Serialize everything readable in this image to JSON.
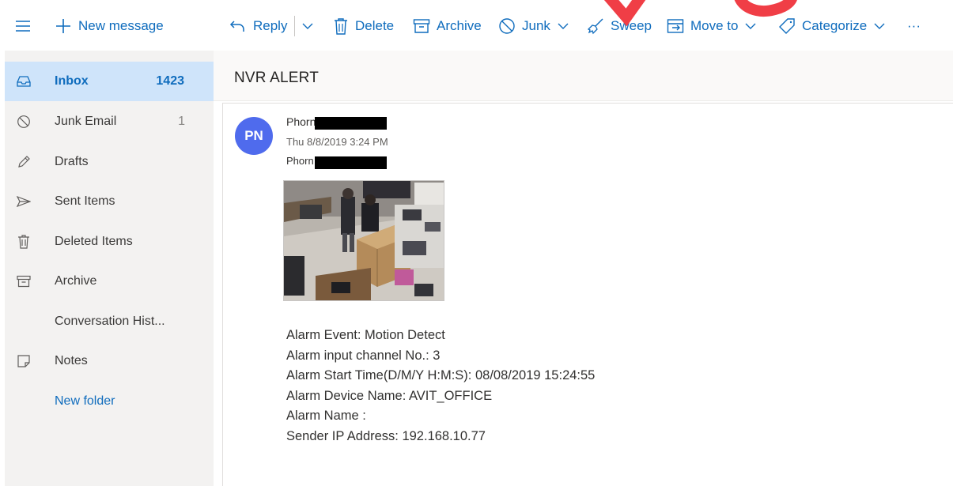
{
  "toolbar": {
    "new_message": "New message",
    "reply": "Reply",
    "delete": "Delete",
    "archive": "Archive",
    "junk": "Junk",
    "sweep": "Sweep",
    "move_to": "Move to",
    "categorize": "Categorize",
    "more": "···"
  },
  "sidebar": {
    "items": [
      {
        "label": "Inbox",
        "count": "1423",
        "icon": "inbox-icon",
        "selected": true
      },
      {
        "label": "Junk Email",
        "count": "1",
        "icon": "junk-icon"
      },
      {
        "label": "Drafts",
        "count": "",
        "icon": "pencil-icon"
      },
      {
        "label": "Sent Items",
        "count": "",
        "icon": "send-icon"
      },
      {
        "label": "Deleted Items",
        "count": "",
        "icon": "trash-icon"
      },
      {
        "label": "Archive",
        "count": "",
        "icon": "archive-icon"
      },
      {
        "label": "Conversation Hist...",
        "count": "",
        "icon": ""
      },
      {
        "label": "Notes",
        "count": "",
        "icon": "note-icon"
      }
    ],
    "new_folder": "New folder"
  },
  "message": {
    "subject": "NVR ALERT",
    "avatar_initials": "PN",
    "sender": "Phorn",
    "date": "Thu 8/8/2019 3:24 PM",
    "recipient": "Phorn",
    "body": [
      "Alarm Event: Motion Detect",
      "Alarm input channel No.: 3",
      "Alarm Start Time(D/M/Y H:M:S): 08/08/2019 15:24:55",
      "Alarm Device Name: AVIT_OFFICE",
      "Alarm Name :",
      "Sender IP Address: 192.168.10.77"
    ]
  },
  "colors": {
    "accent": "#0f6cbd",
    "selected_bg": "#cfe4fa",
    "avatar": "#4f6bed",
    "nav_bg": "#f3f2f1"
  }
}
